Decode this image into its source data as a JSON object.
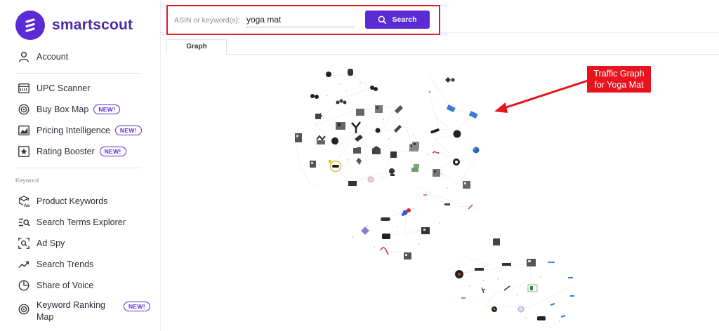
{
  "brand": {
    "name": "smartscout"
  },
  "sidebar": {
    "items": [
      {
        "label": "Account",
        "icon": "user-icon",
        "badge": ""
      },
      {
        "label": "UPC Scanner",
        "icon": "barcode-scanner-icon",
        "badge": ""
      },
      {
        "label": "Buy Box Map",
        "icon": "target-icon",
        "badge": "NEW!"
      },
      {
        "label": "Pricing Intelligence",
        "icon": "price-chart-icon",
        "badge": "NEW!"
      },
      {
        "label": "Rating Booster",
        "icon": "star-box-icon",
        "badge": "NEW!"
      }
    ],
    "section_label": "Keyword",
    "keyword_items": [
      {
        "label": "Product Keywords",
        "icon": "box-keyword-icon",
        "badge": ""
      },
      {
        "label": "Search Terms Explorer",
        "icon": "search-list-icon",
        "badge": ""
      },
      {
        "label": "Ad Spy",
        "icon": "spy-search-icon",
        "badge": ""
      },
      {
        "label": "Search Trends",
        "icon": "trend-line-icon",
        "badge": ""
      },
      {
        "label": "Share of Voice",
        "icon": "pie-icon",
        "badge": ""
      },
      {
        "label_line1": "Keyword Ranking",
        "label_line2": "Map",
        "icon": "target-icon",
        "badge": "NEW!"
      }
    ]
  },
  "search": {
    "label": "ASIN or keyword(s):",
    "value": "yoga mat",
    "button_label": "Search"
  },
  "tabs": [
    {
      "label": "Graph"
    }
  ],
  "annotation": {
    "line1": "Traffic Graph",
    "line2": "for Yoga Mat"
  },
  "colors": {
    "brand_purple": "#5b2bd6",
    "annotation_red": "#e8141d",
    "highlight_border": "#e01b24"
  }
}
